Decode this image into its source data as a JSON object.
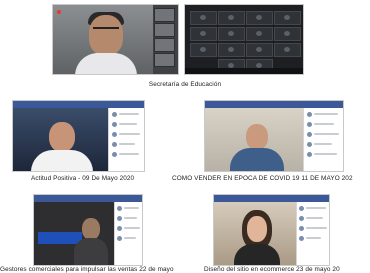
{
  "captions": {
    "top": "Secretaría de Educación",
    "mid_left": "Actitud Positiva - 09 De Mayo 2020",
    "mid_right": "COMO VENDER EN EPOCA DE COVID 19 11 DE MAYO 202",
    "bot_left": "Gestores comerciales para impulsar las ventas 22 de mayo",
    "bot_right": "Diseño del sitio en ecommerce 23 de mayo 20"
  }
}
